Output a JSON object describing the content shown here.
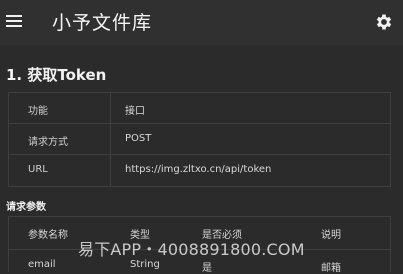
{
  "app": {
    "title": "小予文件库"
  },
  "section": {
    "title": "1. 获取Token"
  },
  "info": {
    "rows": [
      {
        "key": "功能",
        "value": "接口"
      },
      {
        "key": "请求方式",
        "value": "POST"
      },
      {
        "key": "URL",
        "value": "https://img.zltxo.cn/api/token"
      }
    ]
  },
  "params": {
    "title": "请求参数",
    "headers": [
      "参数名称",
      "类型",
      "是否必须",
      "说明"
    ],
    "rows": [
      {
        "name": "email",
        "type": "String",
        "required": "是",
        "desc": "邮箱"
      }
    ]
  },
  "watermark": {
    "text": "易下APP・4008891800.COM"
  },
  "icons": {
    "menu": "menu-icon",
    "settings": "gear-icon"
  },
  "colors": {
    "background": "#2b2b2b",
    "appbar": "#303030",
    "text": "#e6e6e6"
  }
}
